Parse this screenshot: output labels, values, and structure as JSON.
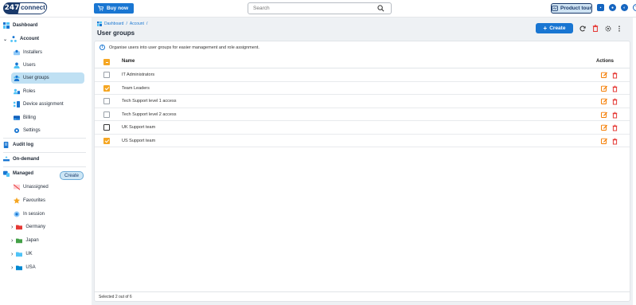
{
  "header": {
    "logo_number": "247",
    "logo_word": "connect",
    "buy_now": "Buy now",
    "search_placeholder": "Search",
    "product_tour": "Product tour"
  },
  "sidebar": {
    "dashboard": "Dashboard",
    "account": "Account",
    "account_items": [
      "Installers",
      "Users",
      "User groups",
      "Roles",
      "Device assignment",
      "Billing",
      "Settings"
    ],
    "audit_log": "Audit log",
    "on_demand": "On-demand",
    "create": "Create",
    "managed": "Managed",
    "managed_items": [
      "Unassigned",
      "Favourites",
      "In session"
    ],
    "groups": [
      "Germany",
      "Japan",
      "UK",
      "USA"
    ]
  },
  "main": {
    "breadcrumb": [
      "Dashboard",
      "Account"
    ],
    "title": "User groups",
    "create_label": "Create",
    "info_text": "Organise users into user groups for easier management and role assignment.",
    "col_name": "Name",
    "col_actions": "Actions",
    "rows": [
      {
        "name": "IT Administrators",
        "checked": false
      },
      {
        "name": "Team Leaders",
        "checked": true
      },
      {
        "name": "Tech Support level 1 access",
        "checked": false
      },
      {
        "name": "Tech Support level 2 access",
        "checked": false
      },
      {
        "name": "UK Support team",
        "checked": false
      },
      {
        "name": "US Support team",
        "checked": true
      }
    ],
    "footer": "Selected 2 out of 6"
  },
  "colors": {
    "brand": "#1a3a6b",
    "primary": "#1976d2",
    "accent": "#f5a623",
    "danger": "#e53935",
    "active_nav": "#bfe0f3"
  }
}
